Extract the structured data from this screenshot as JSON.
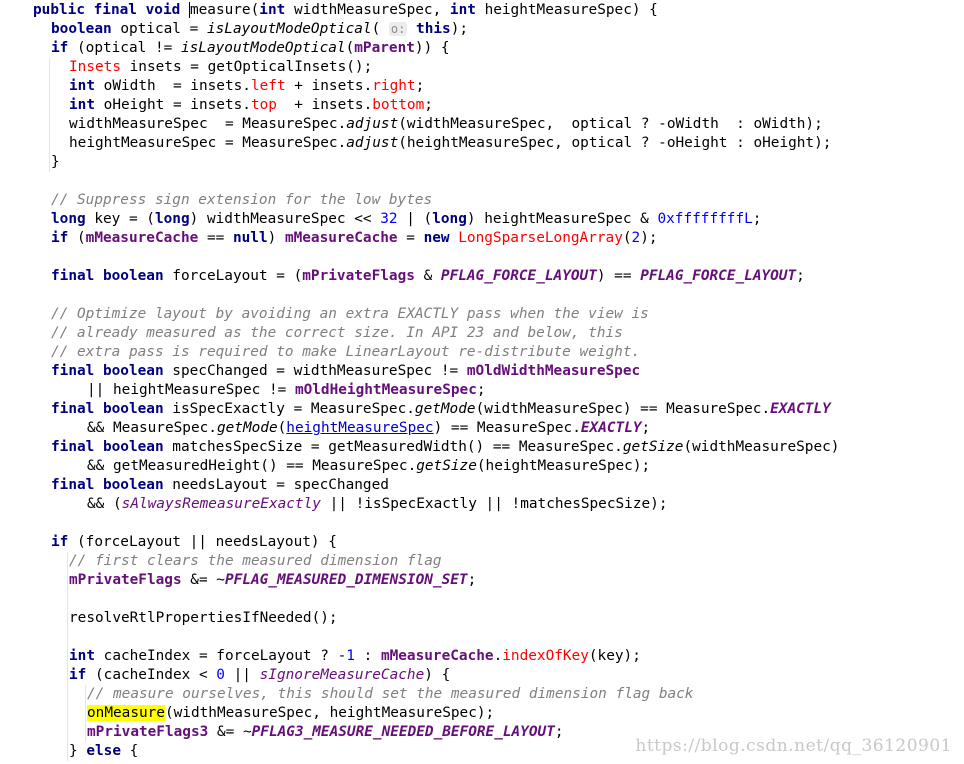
{
  "colors": {
    "keyword": "#000080",
    "field": "#660e7a",
    "number": "#0000ff",
    "comment": "#808080",
    "warning": "#ff0000",
    "highlight": "#ffff00"
  },
  "lines": [
    {
      "indent": 2,
      "tokens": [
        {
          "t": "public final void ",
          "c": "kw"
        },
        {
          "t": "measure",
          "c": "method-decl cursor"
        },
        {
          "t": "("
        },
        {
          "t": "int",
          "c": "kw"
        },
        {
          "t": " widthMeasureSpec, "
        },
        {
          "t": "int",
          "c": "kw"
        },
        {
          "t": " heightMeasureSpec) {"
        }
      ]
    },
    {
      "indent": 4,
      "tokens": [
        {
          "t": "boolean",
          "c": "kw"
        },
        {
          "t": " optical = "
        },
        {
          "t": "isLayoutModeOptical",
          "c": "static"
        },
        {
          "t": "( "
        },
        {
          "t": "o:",
          "c": "hint"
        },
        {
          "t": " "
        },
        {
          "t": "this",
          "c": "kw"
        },
        {
          "t": ");"
        }
      ]
    },
    {
      "indent": 4,
      "tokens": [
        {
          "t": "if",
          "c": "kw"
        },
        {
          "t": " (optical != "
        },
        {
          "t": "isLayoutModeOptical",
          "c": "static"
        },
        {
          "t": "("
        },
        {
          "t": "mParent",
          "c": "field"
        },
        {
          "t": ")) {"
        }
      ]
    },
    {
      "indent": 6,
      "tokens": [
        {
          "t": "Insets",
          "c": "red"
        },
        {
          "t": " insets = getOpticalInsets();"
        }
      ]
    },
    {
      "indent": 6,
      "tokens": [
        {
          "t": "int",
          "c": "kw"
        },
        {
          "t": " oWidth  = insets."
        },
        {
          "t": "left",
          "c": "red"
        },
        {
          "t": " + insets."
        },
        {
          "t": "right",
          "c": "red"
        },
        {
          "t": ";"
        }
      ]
    },
    {
      "indent": 6,
      "tokens": [
        {
          "t": "int",
          "c": "kw"
        },
        {
          "t": " oHeight = insets."
        },
        {
          "t": "top",
          "c": "red"
        },
        {
          "t": "  + insets."
        },
        {
          "t": "bottom",
          "c": "red"
        },
        {
          "t": ";"
        }
      ]
    },
    {
      "indent": 6,
      "tokens": [
        {
          "t": "widthMeasureSpec  = MeasureSpec."
        },
        {
          "t": "adjust",
          "c": "static"
        },
        {
          "t": "(widthMeasureSpec,  optical ? -oWidth  : oWidth);"
        }
      ]
    },
    {
      "indent": 6,
      "tokens": [
        {
          "t": "heightMeasureSpec = MeasureSpec."
        },
        {
          "t": "adjust",
          "c": "static"
        },
        {
          "t": "(heightMeasureSpec, optical ? -oHeight : oHeight);"
        }
      ]
    },
    {
      "indent": 4,
      "tokens": [
        {
          "t": "}"
        }
      ]
    },
    {
      "indent": 0,
      "tokens": []
    },
    {
      "indent": 4,
      "tokens": [
        {
          "t": "// Suppress sign extension for the low bytes",
          "c": "comment"
        }
      ]
    },
    {
      "indent": 4,
      "tokens": [
        {
          "t": "long",
          "c": "kw"
        },
        {
          "t": " key = ("
        },
        {
          "t": "long",
          "c": "kw"
        },
        {
          "t": ") widthMeasureSpec << "
        },
        {
          "t": "32",
          "c": "num"
        },
        {
          "t": " | ("
        },
        {
          "t": "long",
          "c": "kw"
        },
        {
          "t": ") heightMeasureSpec & "
        },
        {
          "t": "0xffffffffL",
          "c": "num"
        },
        {
          "t": ";"
        }
      ]
    },
    {
      "indent": 4,
      "tokens": [
        {
          "t": "if",
          "c": "kw"
        },
        {
          "t": " ("
        },
        {
          "t": "mMeasureCache",
          "c": "field"
        },
        {
          "t": " == "
        },
        {
          "t": "null",
          "c": "kw"
        },
        {
          "t": ") "
        },
        {
          "t": "mMeasureCache",
          "c": "field"
        },
        {
          "t": " = "
        },
        {
          "t": "new",
          "c": "kw"
        },
        {
          "t": " "
        },
        {
          "t": "LongSparseLongArray",
          "c": "red"
        },
        {
          "t": "("
        },
        {
          "t": "2",
          "c": "num"
        },
        {
          "t": ");"
        }
      ]
    },
    {
      "indent": 0,
      "tokens": []
    },
    {
      "indent": 4,
      "tokens": [
        {
          "t": "final boolean",
          "c": "kw"
        },
        {
          "t": " forceLayout = ("
        },
        {
          "t": "mPrivateFlags",
          "c": "field"
        },
        {
          "t": " & "
        },
        {
          "t": "PFLAG_FORCE_LAYOUT",
          "c": "sfield"
        },
        {
          "t": ") == "
        },
        {
          "t": "PFLAG_FORCE_LAYOUT",
          "c": "sfield"
        },
        {
          "t": ";"
        }
      ]
    },
    {
      "indent": 0,
      "tokens": []
    },
    {
      "indent": 4,
      "tokens": [
        {
          "t": "// Optimize layout by avoiding an extra EXACTLY pass when the view is",
          "c": "comment"
        }
      ]
    },
    {
      "indent": 4,
      "tokens": [
        {
          "t": "// already measured as the correct size. In API 23 and below, this",
          "c": "comment"
        }
      ]
    },
    {
      "indent": 4,
      "tokens": [
        {
          "t": "// extra pass is required to make LinearLayout re-distribute weight.",
          "c": "comment"
        }
      ]
    },
    {
      "indent": 4,
      "tokens": [
        {
          "t": "final boolean",
          "c": "kw"
        },
        {
          "t": " specChanged = widthMeasureSpec != "
        },
        {
          "t": "mOldWidthMeasureSpec",
          "c": "field"
        }
      ]
    },
    {
      "indent": 8,
      "tokens": [
        {
          "t": "|| heightMeasureSpec != "
        },
        {
          "t": "mOldHeightMeasureSpec",
          "c": "field"
        },
        {
          "t": ";"
        }
      ]
    },
    {
      "indent": 4,
      "tokens": [
        {
          "t": "final boolean",
          "c": "kw"
        },
        {
          "t": " isSpecExactly = MeasureSpec."
        },
        {
          "t": "getMode",
          "c": "static"
        },
        {
          "t": "(widthMeasureSpec) == MeasureSpec."
        },
        {
          "t": "EXACTLY",
          "c": "sfield"
        }
      ]
    },
    {
      "indent": 8,
      "tokens": [
        {
          "t": "&& MeasureSpec."
        },
        {
          "t": "getMode",
          "c": "static"
        },
        {
          "t": "("
        },
        {
          "t": "heightMeasureSpec",
          "c": "link"
        },
        {
          "t": ") == MeasureSpec."
        },
        {
          "t": "EXACTLY",
          "c": "sfield"
        },
        {
          "t": ";"
        }
      ]
    },
    {
      "indent": 4,
      "tokens": [
        {
          "t": "final boolean",
          "c": "kw"
        },
        {
          "t": " matchesSpecSize = getMeasuredWidth() == MeasureSpec."
        },
        {
          "t": "getSize",
          "c": "static"
        },
        {
          "t": "(widthMeasureSpec)"
        }
      ]
    },
    {
      "indent": 8,
      "tokens": [
        {
          "t": "&& getMeasuredHeight() == MeasureSpec."
        },
        {
          "t": "getSize",
          "c": "static"
        },
        {
          "t": "(heightMeasureSpec);"
        }
      ]
    },
    {
      "indent": 4,
      "tokens": [
        {
          "t": "final boolean",
          "c": "kw"
        },
        {
          "t": " needsLayout = specChanged"
        }
      ]
    },
    {
      "indent": 8,
      "tokens": [
        {
          "t": "&& ("
        },
        {
          "t": "sAlwaysRemeasureExactly",
          "c": "ifield"
        },
        {
          "t": " || !isSpecExactly || !matchesSpecSize);"
        }
      ]
    },
    {
      "indent": 0,
      "tokens": []
    },
    {
      "indent": 4,
      "tokens": [
        {
          "t": "if",
          "c": "kw"
        },
        {
          "t": " (forceLayout || needsLayout) {"
        }
      ]
    },
    {
      "indent": 6,
      "tokens": [
        {
          "t": "// first clears the measured dimension flag",
          "c": "comment"
        }
      ]
    },
    {
      "indent": 6,
      "tokens": [
        {
          "t": "mPrivateFlags",
          "c": "field"
        },
        {
          "t": " &= ~"
        },
        {
          "t": "PFLAG_MEASURED_DIMENSION_SET",
          "c": "sfield"
        },
        {
          "t": ";"
        }
      ]
    },
    {
      "indent": 0,
      "tokens": []
    },
    {
      "indent": 6,
      "tokens": [
        {
          "t": "resolveRtlPropertiesIfNeeded();"
        }
      ]
    },
    {
      "indent": 0,
      "tokens": []
    },
    {
      "indent": 6,
      "tokens": [
        {
          "t": "int",
          "c": "kw"
        },
        {
          "t": " cacheIndex = forceLayout ? -"
        },
        {
          "t": "1",
          "c": "num"
        },
        {
          "t": " : "
        },
        {
          "t": "mMeasureCache",
          "c": "field"
        },
        {
          "t": "."
        },
        {
          "t": "indexOfKey",
          "c": "red"
        },
        {
          "t": "(key);"
        }
      ]
    },
    {
      "indent": 6,
      "tokens": [
        {
          "t": "if",
          "c": "kw"
        },
        {
          "t": " (cacheIndex < "
        },
        {
          "t": "0",
          "c": "num"
        },
        {
          "t": " || "
        },
        {
          "t": "sIgnoreMeasureCache",
          "c": "ifield"
        },
        {
          "t": ") {"
        }
      ]
    },
    {
      "indent": 8,
      "tokens": [
        {
          "t": "// measure ourselves, this should set the measured dimension flag back",
          "c": "comment"
        }
      ]
    },
    {
      "indent": 8,
      "tokens": [
        {
          "t": "onMeasure",
          "c": "hl"
        },
        {
          "t": "(widthMeasureSpec, heightMeasureSpec);"
        }
      ]
    },
    {
      "indent": 8,
      "tokens": [
        {
          "t": "mPrivateFlags3",
          "c": "field"
        },
        {
          "t": " &= ~"
        },
        {
          "t": "PFLAG3_MEASURE_NEEDED_BEFORE_LAYOUT",
          "c": "sfield"
        },
        {
          "t": ";"
        }
      ]
    },
    {
      "indent": 6,
      "tokens": [
        {
          "t": "} "
        },
        {
          "t": "else",
          "c": "kw"
        },
        {
          "t": " {"
        }
      ]
    }
  ],
  "watermark": "https://blog.csdn.net/qq_36120901"
}
